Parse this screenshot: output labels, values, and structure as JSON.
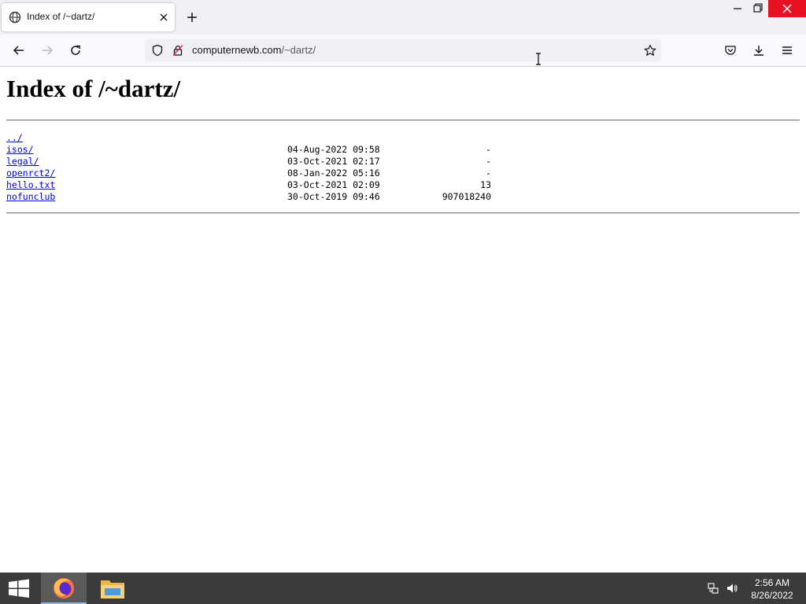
{
  "browser": {
    "tab_title": "Index of /~dartz/",
    "url_host": "computernewb.com",
    "url_path": "/~dartz/"
  },
  "page": {
    "title": "Index of /~dartz/",
    "parent_link": "../",
    "entries": [
      {
        "name": "isos/",
        "date": "04-Aug-2022 09:58",
        "size": "-"
      },
      {
        "name": "legal/",
        "date": "03-Oct-2021 02:17",
        "size": "-"
      },
      {
        "name": "openrct2/",
        "date": "08-Jan-2022 05:16",
        "size": "-"
      },
      {
        "name": "hello.txt",
        "date": "03-Oct-2021 02:09",
        "size": "13"
      },
      {
        "name": "nofunclub",
        "date": "30-Oct-2019 09:46",
        "size": "907018240"
      }
    ]
  },
  "taskbar": {
    "time": "2:56 AM",
    "date": "8/26/2022"
  },
  "icons": {
    "tab": "globe-favicon-icon",
    "close": "close-icon",
    "new_tab": "plus-icon",
    "back": "back-arrow-icon",
    "forward": "forward-arrow-icon",
    "reload": "reload-icon",
    "shield": "tracking-shield-icon",
    "lock": "insecure-lock-icon",
    "bookmark": "star-icon",
    "pocket": "pocket-icon",
    "downloads": "download-icon",
    "menu": "hamburger-menu-icon"
  },
  "colors": {
    "link": "#0000ee",
    "taskbar": "#3b3b3b",
    "close_button": "#e81123"
  }
}
